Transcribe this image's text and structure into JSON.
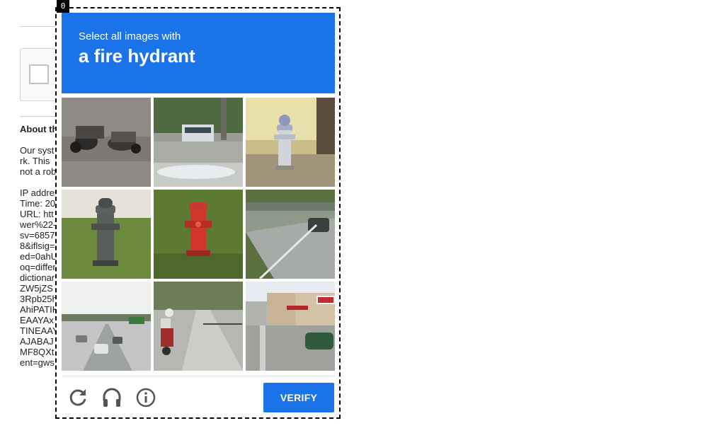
{
  "background_page": {
    "about_heading": "About this page",
    "body_lines": [
      "Our systems have detected unusual traffic from your computer network. This page checks to see if it's really you sending the requests, and not a robot."
    ],
    "meta_lines": [
      "IP address:",
      "Time: 20",
      "URL: htt",
      "wer%22-",
      "sv=6857",
      "8&iflsig=",
      "ed=0ahU",
      "oq=differ",
      "dictionar",
      "ZW5jZS",
      "3Rpb25h",
      "AhiPATIK",
      "EAAYAx",
      "TINEAAY",
      "AJABAJ",
      "MF8QXt",
      "ent=gws"
    ]
  },
  "challenge": {
    "frame_index": "0",
    "prompt_sub": "Select all images with",
    "prompt_main": "a fire hydrant",
    "tiles": [
      {
        "subject": "motorcycles parked on street"
      },
      {
        "subject": "bus on road"
      },
      {
        "subject": "fire hydrant by tree"
      },
      {
        "subject": "fire hydrant on grass"
      },
      {
        "subject": "red fire hydrant"
      },
      {
        "subject": "road with car"
      },
      {
        "subject": "highway traffic"
      },
      {
        "subject": "motorcyclist on road"
      },
      {
        "subject": "street corner with store"
      }
    ],
    "footer": {
      "reload_icon": "reload-icon",
      "audio_icon": "headphones-icon",
      "info_icon": "info-icon",
      "verify_label": "VERIFY"
    },
    "colors": {
      "accent": "#1a73e8"
    }
  }
}
